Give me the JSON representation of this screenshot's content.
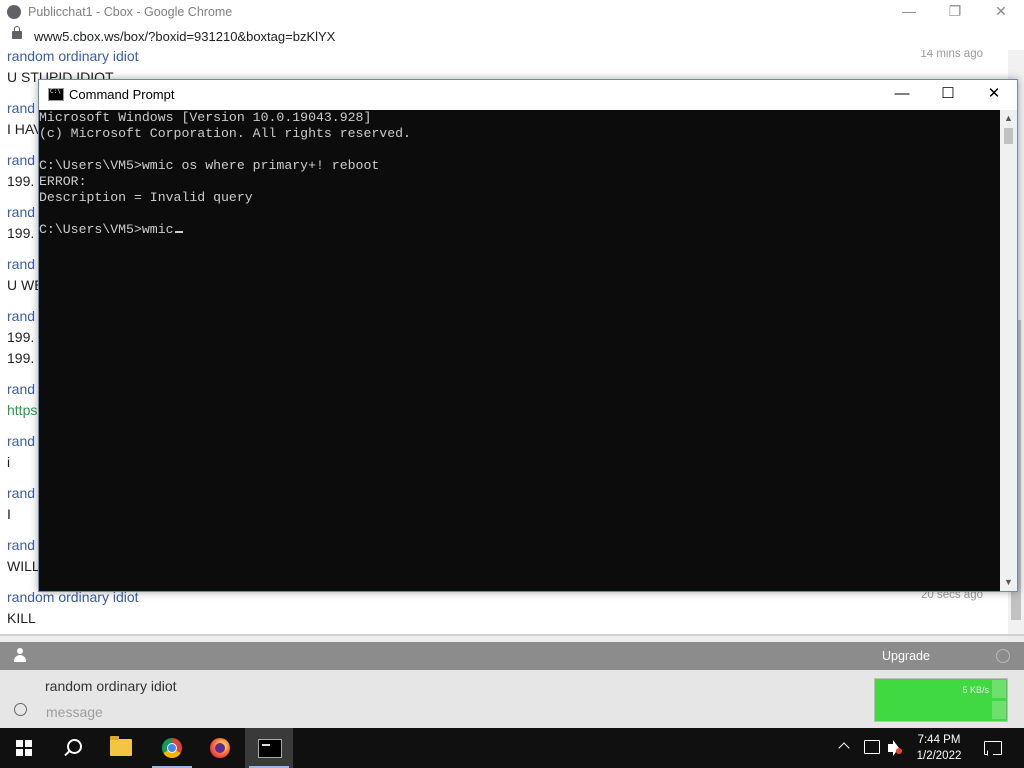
{
  "browser": {
    "title": "Publicchat1 - Cbox - Google Chrome",
    "url": "www5.cbox.ws/box/?boxid=931210&boxtag=bzKlYX",
    "minimize": "—",
    "restore": "❐",
    "close": "✕"
  },
  "chat": {
    "messages": [
      {
        "name": "random ordinary idiot",
        "text": "U STUPID IDIOT",
        "time": "14 mins ago",
        "link": false
      },
      {
        "name": "rand",
        "text": "I HAV",
        "time": "",
        "link": false
      },
      {
        "name": "rand",
        "text": "199.",
        "time": "",
        "link": false
      },
      {
        "name": "rand",
        "text": "199.",
        "time": "",
        "link": false
      },
      {
        "name": "rand",
        "text": "U WE",
        "time": "",
        "link": false
      },
      {
        "name": "rand",
        "text": "199.",
        "text2": "199.",
        "time": "",
        "link": false
      },
      {
        "name": "rand",
        "text": "https",
        "time": "",
        "link": true
      },
      {
        "name": "rand",
        "text": "i",
        "time": "",
        "link": false
      },
      {
        "name": "rand",
        "text": "I",
        "time": "",
        "link": false
      },
      {
        "name": "rand",
        "text": "WILL",
        "time": "",
        "link": false
      },
      {
        "name": "random ordinary idiot",
        "text": "KILL",
        "time": "20 secs ago",
        "link": false
      }
    ],
    "upgrade_label": "Upgrade",
    "username": "random ordinary idiot",
    "message_placeholder": "message",
    "net_speed": "5 KB/s"
  },
  "cmd": {
    "title": "Command Prompt",
    "minimize": "—",
    "maximize": "☐",
    "close": "✕",
    "lines": [
      "Microsoft Windows [Version 10.0.19043.928]",
      "(c) Microsoft Corporation. All rights reserved.",
      "",
      "C:\\Users\\VM5>wmic os where primary+! reboot",
      "ERROR:",
      "Description = Invalid query",
      "",
      "C:\\Users\\VM5>wmic"
    ]
  },
  "taskbar": {
    "time": "7:44 PM",
    "date": "1/2/2022"
  }
}
